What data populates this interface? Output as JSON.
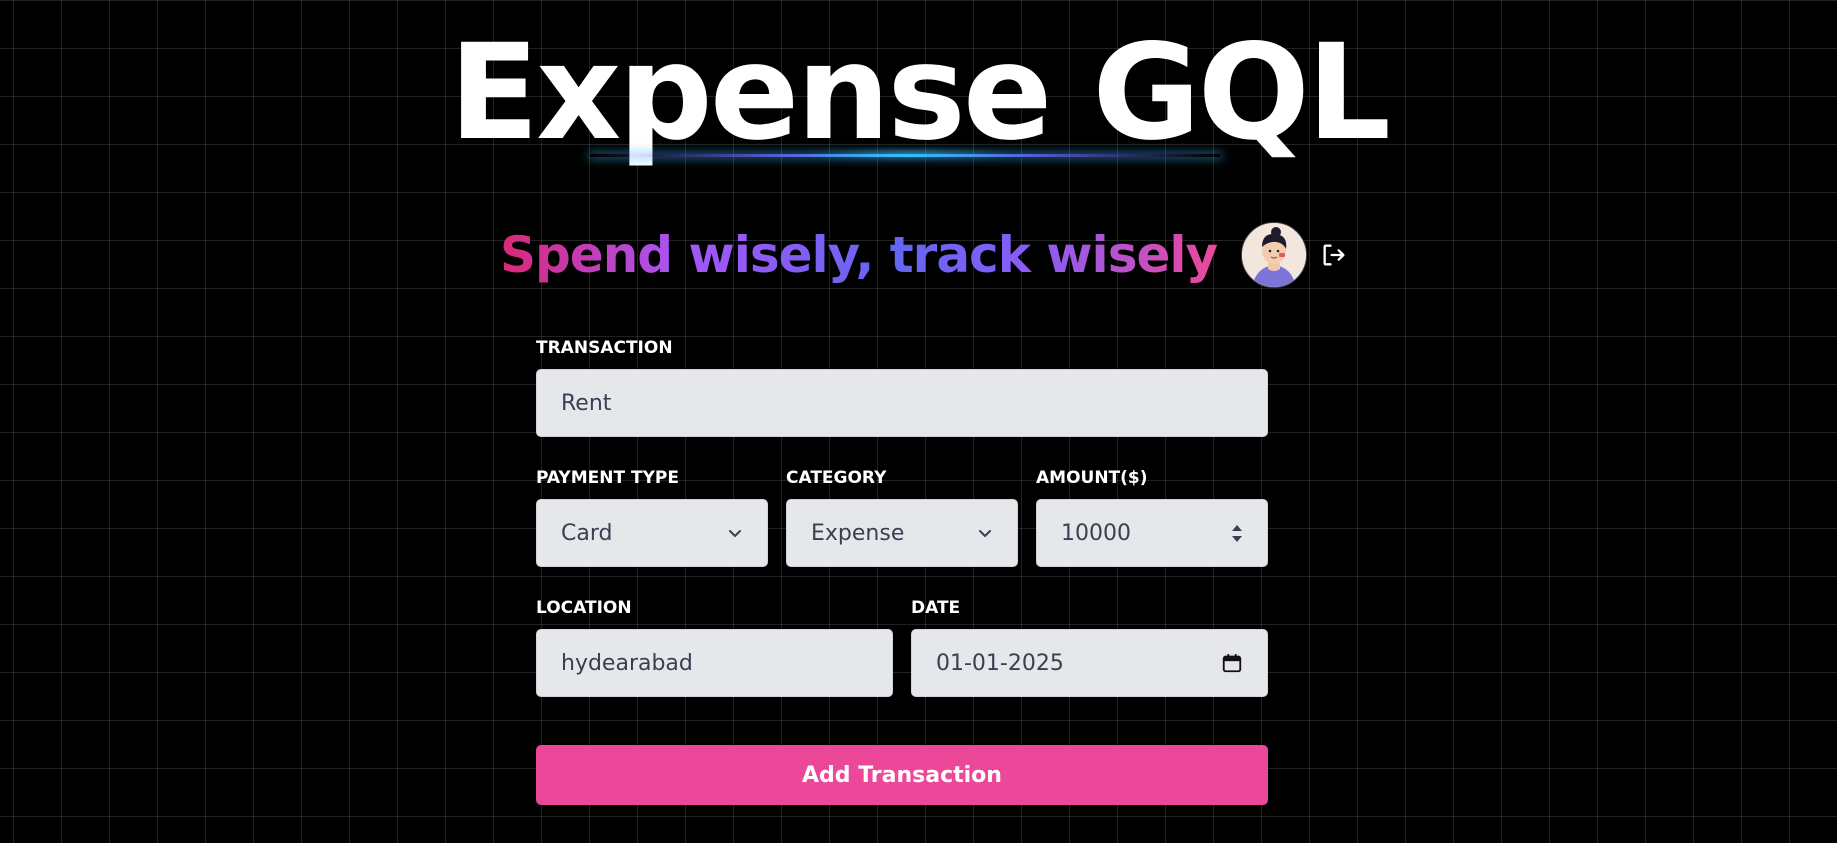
{
  "header": {
    "title": "Expense GQL",
    "tagline": "Spend wisely, track wisely"
  },
  "form": {
    "transaction": {
      "label": "Transaction",
      "value": "Rent"
    },
    "payment_type": {
      "label": "Payment Type",
      "value": "Card"
    },
    "category": {
      "label": "Category",
      "value": "Expense"
    },
    "amount": {
      "label": "Amount($)",
      "value": "10000"
    },
    "location": {
      "label": "Location",
      "value": "hydearabad"
    },
    "date": {
      "label": "Date",
      "value": "01-01-2025"
    },
    "submit_label": "Add Transaction"
  },
  "colors": {
    "background": "#000000",
    "accent": "#ec4899",
    "field_bg": "#e5e7eb"
  },
  "icons": [
    "avatar",
    "logout-icon",
    "chevron-down-icon",
    "spinner-icon",
    "calendar-icon"
  ]
}
